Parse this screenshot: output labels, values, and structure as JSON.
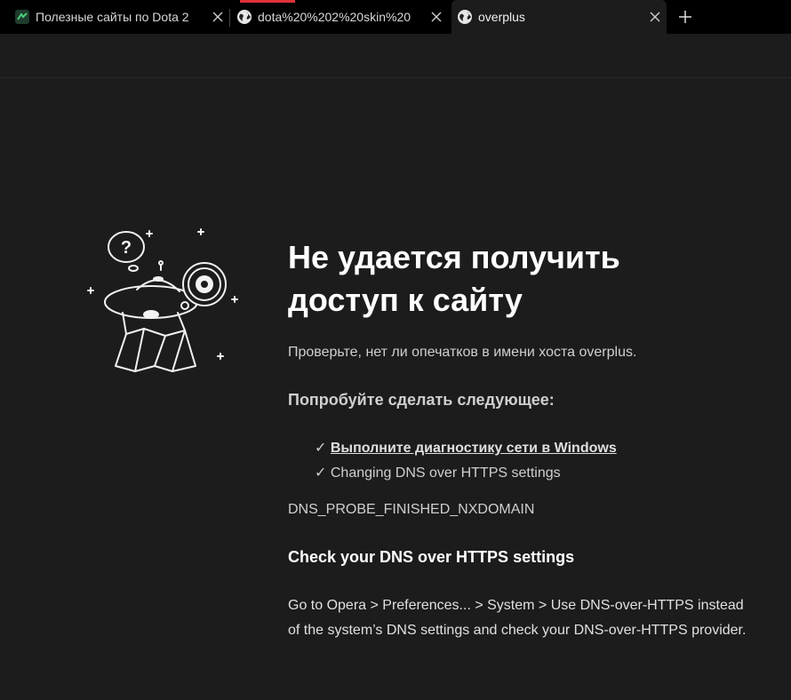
{
  "tabs": [
    {
      "title": "Полезные сайты по Dota 2",
      "favicon": "dota-app-icon",
      "active": false
    },
    {
      "title": "dota%20%202%20skin%20",
      "favicon": "globe-icon",
      "active": false
    },
    {
      "title": "overplus",
      "favicon": "globe-icon",
      "active": true
    }
  ],
  "colors": {
    "accent_loading": "#e0323a",
    "background": "#1c1c1c",
    "tabbar": "#000000"
  },
  "error": {
    "heading": "Не удается получить доступ к сайту",
    "check_text": "Проверьте, нет ли опечатков в имени хоста overplus.",
    "try_title": "Попробуйте сделать следующее:",
    "suggestions": [
      {
        "check": "✓",
        "text": "Выполните диагностику сети в Windows",
        "is_link": true
      },
      {
        "check": "✓",
        "text": "Changing DNS over HTTPS settings",
        "is_link": false
      }
    ],
    "code": "DNS_PROBE_FINISHED_NXDOMAIN",
    "dns_title": "Check your DNS over HTTPS settings",
    "dns_body": "Go to Opera > Preferences... > System > Use DNS-over-HTTPS instead of the system’s DNS settings and check your DNS-over-HTTPS provider."
  },
  "illustration": {
    "icon": "lost-ufo-map-illustration",
    "bubble_text": "?"
  }
}
